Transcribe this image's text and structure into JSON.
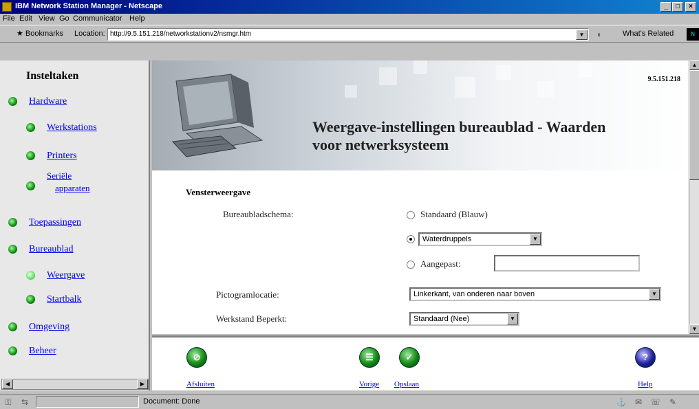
{
  "window": {
    "title": "IBM Network Station Manager - Netscape"
  },
  "menu": {
    "items": [
      "File",
      "Edit",
      "View",
      "Go",
      "Communicator",
      "Help"
    ]
  },
  "toolbar": {
    "bookmarks_label": "Bookmarks",
    "location_label": "Location:",
    "url": "http://9.5.151.218/networkstationv2/nsmgr.htm",
    "related_label": "What's Related"
  },
  "sidebar": {
    "heading": "Insteltaken",
    "items": [
      {
        "label": "Hardware",
        "level": 0
      },
      {
        "label": "Werkstations",
        "level": 1
      },
      {
        "label": "Printers",
        "level": 1
      },
      {
        "label": "Seriële",
        "label2": "apparaten",
        "level": 1
      },
      {
        "label": "Toepassingen",
        "level": 0
      },
      {
        "label": "Bureaublad",
        "level": 0
      },
      {
        "label": "Weergave",
        "level": 1,
        "active": true
      },
      {
        "label": "Startbalk",
        "level": 1
      },
      {
        "label": "Omgeving",
        "level": 0
      },
      {
        "label": "Beheer",
        "level": 0
      }
    ]
  },
  "header": {
    "ip": "9.5.151.218",
    "title_line1": "Weergave-instellingen bureaublad - Waarden",
    "title_line2": "voor netwerksysteem"
  },
  "form": {
    "section": "Vensterweergave",
    "schema_label": "Bureaubladschema:",
    "radio_standard": "Standaard (Blauw)",
    "radio_standard_checked": false,
    "scheme_select_value": "Waterdruppels",
    "radio_scheme_checked": true,
    "radio_custom": "Aangepast:",
    "radio_custom_checked": false,
    "custom_value": "",
    "icon_label": "Pictogramlocatie:",
    "icon_value": "Linkerkant, van onderen naar boven",
    "restricted_label": "Werkstand Beperkt:",
    "restricted_value": "Standaard (Nee)"
  },
  "bottom": {
    "cancel_label": "Afsluiten",
    "prev_label": "Vorige",
    "save_label": "Opslaan",
    "help_label": "Help"
  },
  "statusbar": {
    "text": "Document: Done"
  },
  "colors": {
    "title_bar": "#000080",
    "link": "#0000ee",
    "bullet": "#0a8a0a"
  }
}
